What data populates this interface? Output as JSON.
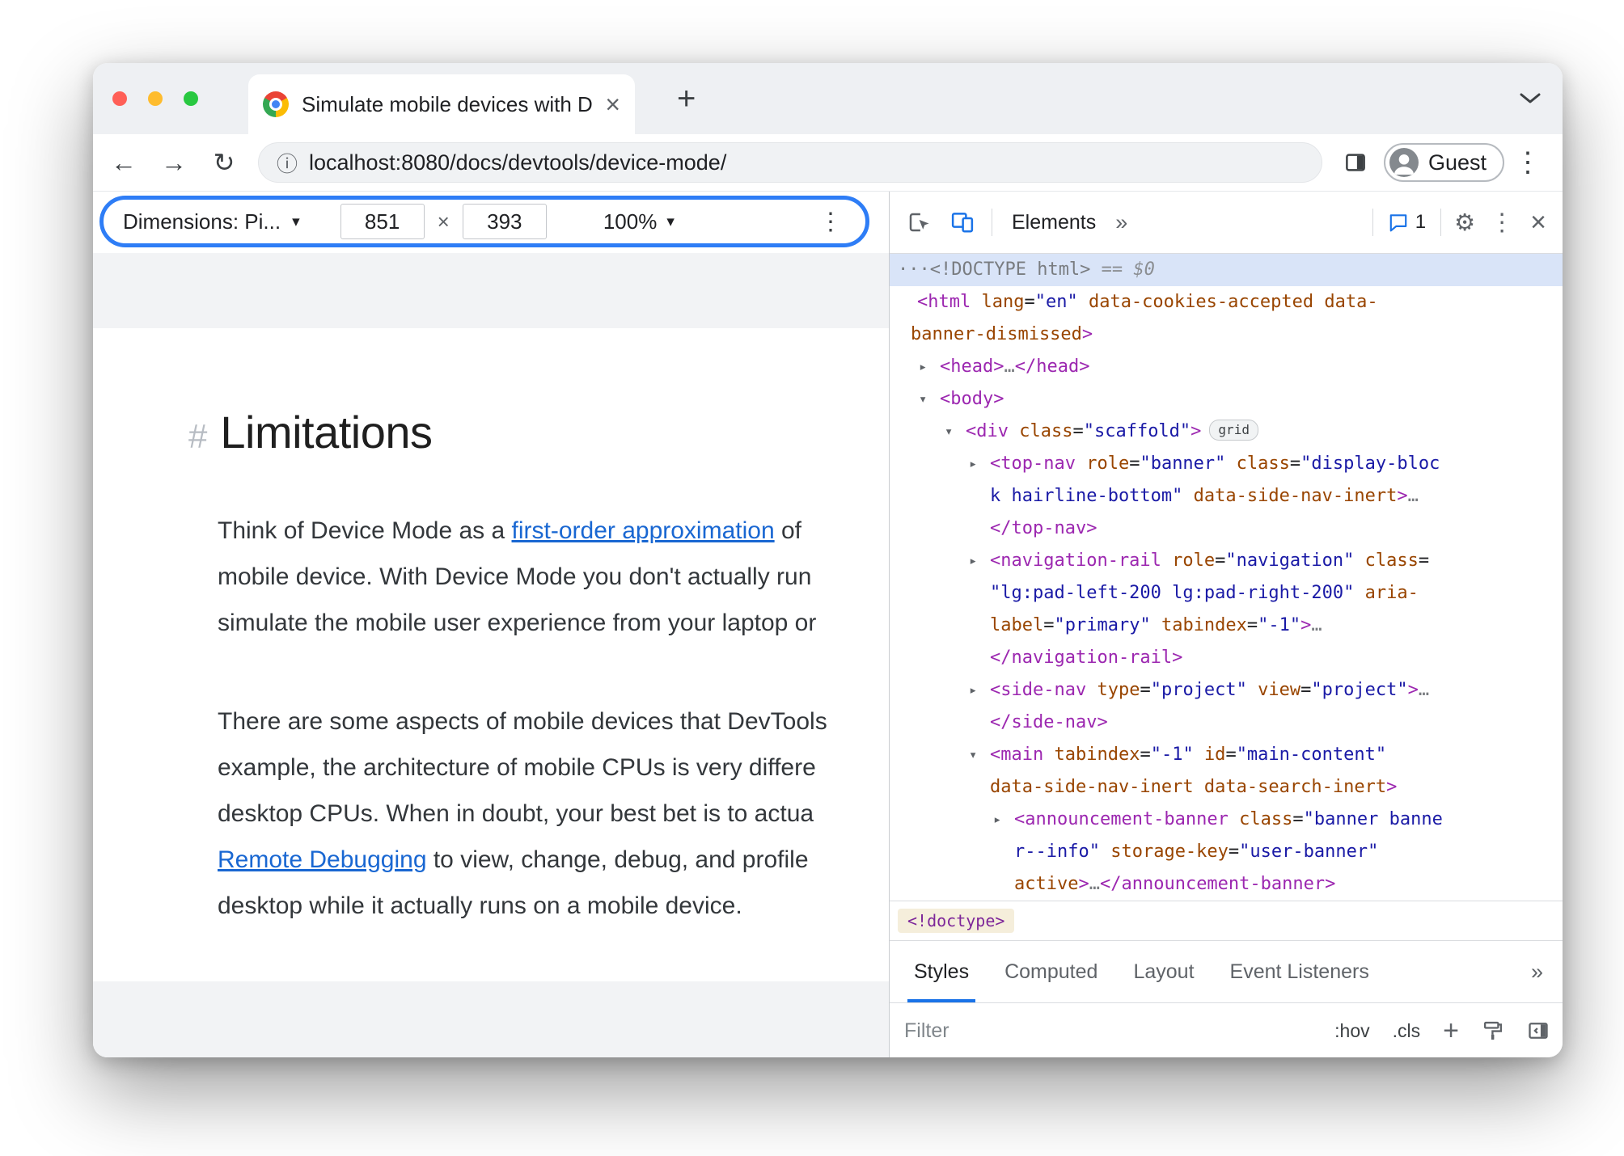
{
  "colors": {
    "accent_blue": "#1a73e8",
    "highlight_ring": "#2e7df6",
    "selected_line_bg": "#d9e4f8",
    "tag_token": "#9c27b0",
    "attribute_token": "#994500",
    "value_token": "#1a1aa6",
    "link": "#1967d2",
    "traffic_red": "#ff5f57",
    "traffic_yellow": "#febc2e",
    "traffic_green": "#28c840"
  },
  "window": {
    "tab": {
      "title": "Simulate mobile devices with D",
      "close_glyph": "×",
      "new_tab_glyph": "+"
    },
    "address_bar": {
      "back_glyph": "←",
      "forward_glyph": "→",
      "reload_glyph": "↻",
      "info_glyph": "ⓘ",
      "url": "localhost:8080/docs/devtools/device-mode/",
      "profile_label": "Guest",
      "menu_glyph": "⋮"
    },
    "device_toolbar": {
      "dimensions_label": "Dimensions: Pi...",
      "caret": "▾",
      "width_value": "851",
      "multiply": "×",
      "height_value": "393",
      "zoom_value": "100%",
      "menu_glyph": "⋮"
    },
    "page": {
      "heading": {
        "hash": "#",
        "text": "Limitations"
      },
      "paragraphs": [
        {
          "lines": [
            [
              [
                "t",
                "Think of Device Mode as a "
              ],
              [
                "l",
                "first-order approximation"
              ],
              [
                "t",
                " of"
              ]
            ],
            [
              [
                "t",
                "mobile device. With Device Mode you don't actually run"
              ]
            ],
            [
              [
                "t",
                "simulate the mobile user experience from your laptop or"
              ]
            ]
          ]
        },
        {
          "lines": [
            [
              [
                "t",
                "There are some aspects of mobile devices that DevTools"
              ]
            ],
            [
              [
                "t",
                "example, the architecture of mobile CPUs is very differe"
              ]
            ],
            [
              [
                "t",
                "desktop CPUs. When in doubt, your best bet is to actua"
              ]
            ],
            [
              [
                "l",
                "Remote Debugging"
              ],
              [
                "t",
                " to view, change, debug, and profile"
              ]
            ],
            [
              [
                "t",
                "desktop while it actually runs on a mobile device."
              ]
            ]
          ]
        }
      ]
    },
    "devtools": {
      "toolbar": {
        "panel_tab": "Elements",
        "more_glyph": "»",
        "issues_count": "1",
        "settings_glyph": "⚙",
        "menu_glyph": "⋮",
        "close_glyph": "×"
      },
      "tree": {
        "lines": [
          {
            "pad": 10,
            "sel": true,
            "seg": [
              [
                "g",
                "···"
              ],
              [
                "g",
                "<!DOCTYPE html>"
              ],
              [
                "f",
                " == $0"
              ]
            ]
          },
          {
            "pad": 34,
            "seg": [
              [
                "t",
                "<html"
              ],
              [
                "p",
                " "
              ],
              [
                "a",
                "lang"
              ],
              [
                "p",
                "="
              ],
              [
                "v",
                "\"en\""
              ],
              [
                "p",
                " "
              ],
              [
                "a",
                "data-cookies-accepted"
              ],
              [
                "p",
                " "
              ],
              [
                "a",
                "data-"
              ]
            ]
          },
          {
            "pad": 26,
            "seg": [
              [
                "a",
                "banner-dismissed"
              ],
              [
                "t",
                ">"
              ]
            ]
          },
          {
            "pad": 62,
            "arrow": "r",
            "seg": [
              [
                "t",
                "<head>"
              ],
              [
                "g",
                "…"
              ],
              [
                "t",
                "</head>"
              ]
            ]
          },
          {
            "pad": 62,
            "arrow": "d",
            "seg": [
              [
                "t",
                "<body>"
              ]
            ]
          },
          {
            "pad": 94,
            "arrow": "d",
            "seg": [
              [
                "t",
                "<div"
              ],
              [
                "p",
                " "
              ],
              [
                "a",
                "class"
              ],
              [
                "p",
                "="
              ],
              [
                "v",
                "\"scaffold\""
              ],
              [
                "t",
                ">"
              ],
              [
                "b",
                "grid"
              ]
            ]
          },
          {
            "pad": 124,
            "arrow": "r",
            "seg": [
              [
                "t",
                "<top-nav"
              ],
              [
                "p",
                " "
              ],
              [
                "a",
                "role"
              ],
              [
                "p",
                "="
              ],
              [
                "v",
                "\"banner\""
              ],
              [
                "p",
                " "
              ],
              [
                "a",
                "class"
              ],
              [
                "p",
                "="
              ],
              [
                "v",
                "\"display-bloc"
              ]
            ]
          },
          {
            "pad": 124,
            "seg": [
              [
                "v",
                "k hairline-bottom\""
              ],
              [
                "p",
                " "
              ],
              [
                "a",
                "data-side-nav-inert"
              ],
              [
                "t",
                ">"
              ],
              [
                "g",
                "…"
              ]
            ]
          },
          {
            "pad": 124,
            "seg": [
              [
                "t",
                "</top-nav>"
              ]
            ]
          },
          {
            "pad": 124,
            "arrow": "r",
            "seg": [
              [
                "t",
                "<navigation-rail"
              ],
              [
                "p",
                " "
              ],
              [
                "a",
                "role"
              ],
              [
                "p",
                "="
              ],
              [
                "v",
                "\"navigation\""
              ],
              [
                "p",
                " "
              ],
              [
                "a",
                "class"
              ],
              [
                "p",
                "="
              ]
            ]
          },
          {
            "pad": 124,
            "seg": [
              [
                "v",
                "\"lg:pad-left-200 lg:pad-right-200\""
              ],
              [
                "p",
                " "
              ],
              [
                "a",
                "aria-"
              ]
            ]
          },
          {
            "pad": 124,
            "seg": [
              [
                "a",
                "label"
              ],
              [
                "p",
                "="
              ],
              [
                "v",
                "\"primary\""
              ],
              [
                "p",
                " "
              ],
              [
                "a",
                "tabindex"
              ],
              [
                "p",
                "="
              ],
              [
                "v",
                "\"-1\""
              ],
              [
                "t",
                ">"
              ],
              [
                "g",
                "…"
              ]
            ]
          },
          {
            "pad": 124,
            "seg": [
              [
                "t",
                "</navigation-rail>"
              ]
            ]
          },
          {
            "pad": 124,
            "arrow": "r",
            "seg": [
              [
                "t",
                "<side-nav"
              ],
              [
                "p",
                " "
              ],
              [
                "a",
                "type"
              ],
              [
                "p",
                "="
              ],
              [
                "v",
                "\"project\""
              ],
              [
                "p",
                " "
              ],
              [
                "a",
                "view"
              ],
              [
                "p",
                "="
              ],
              [
                "v",
                "\"project\""
              ],
              [
                "t",
                ">"
              ],
              [
                "g",
                "…"
              ]
            ]
          },
          {
            "pad": 124,
            "seg": [
              [
                "t",
                "</side-nav>"
              ]
            ]
          },
          {
            "pad": 124,
            "arrow": "d",
            "seg": [
              [
                "t",
                "<main"
              ],
              [
                "p",
                " "
              ],
              [
                "a",
                "tabindex"
              ],
              [
                "p",
                "="
              ],
              [
                "v",
                "\"-1\""
              ],
              [
                "p",
                " "
              ],
              [
                "a",
                "id"
              ],
              [
                "p",
                "="
              ],
              [
                "v",
                "\"main-content\""
              ]
            ]
          },
          {
            "pad": 124,
            "seg": [
              [
                "a",
                "data-side-nav-inert"
              ],
              [
                "p",
                " "
              ],
              [
                "a",
                "data-search-inert"
              ],
              [
                "t",
                ">"
              ]
            ]
          },
          {
            "pad": 154,
            "arrow": "r",
            "seg": [
              [
                "t",
                "<announcement-banner"
              ],
              [
                "p",
                " "
              ],
              [
                "a",
                "class"
              ],
              [
                "p",
                "="
              ],
              [
                "v",
                "\"banner banne"
              ]
            ]
          },
          {
            "pad": 154,
            "seg": [
              [
                "v",
                "r--info\""
              ],
              [
                "p",
                " "
              ],
              [
                "a",
                "storage-key"
              ],
              [
                "p",
                "="
              ],
              [
                "v",
                "\"user-banner\""
              ]
            ]
          },
          {
            "pad": 154,
            "seg": [
              [
                "a",
                "active"
              ],
              [
                "t",
                ">"
              ],
              [
                "g",
                "…"
              ],
              [
                "t",
                "</announcement-banner>"
              ]
            ]
          }
        ]
      },
      "breadcrumb": {
        "label": "<!doctype>"
      },
      "styles_tabs": [
        "Styles",
        "Computed",
        "Layout",
        "Event Listeners"
      ],
      "subtabs_more_glyph": "»",
      "filter": {
        "placeholder": "Filter",
        "pseudo": ":hov",
        "cls": ".cls",
        "add_glyph": "+"
      }
    }
  }
}
